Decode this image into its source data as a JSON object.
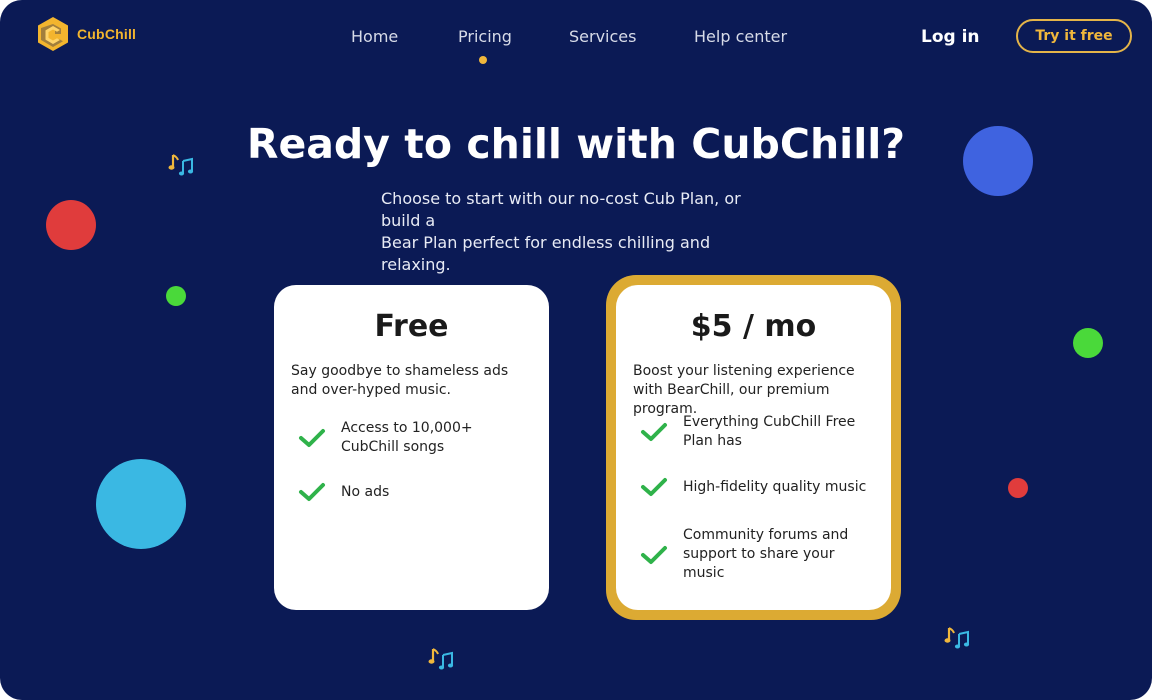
{
  "brand": {
    "name": "CubChill",
    "accent": "#f0b73c",
    "background": "#0b1a55"
  },
  "nav": {
    "items": [
      {
        "label": "Home"
      },
      {
        "label": "Pricing",
        "active": true
      },
      {
        "label": "Services"
      },
      {
        "label": "Help center"
      }
    ],
    "login_label": "Log in",
    "cta_label": "Try it free"
  },
  "hero": {
    "title": "Ready to chill with CubChill?",
    "subtitle_line1": "Choose to start with our no-cost Cub Plan, or build a",
    "subtitle_line2": "Bear Plan perfect for endless chilling and relaxing."
  },
  "plans": [
    {
      "title": "Free",
      "description": "Say goodbye to shameless ads and over-hyped music.",
      "features": [
        {
          "text": "Access to 10,000+ CubChill songs"
        },
        {
          "text": "No ads"
        }
      ]
    },
    {
      "title": "$5 / mo",
      "description": "Boost your listening experience with BearChill, our premium program.",
      "highlight_color": "#dcaa33",
      "features": [
        {
          "text": "Everything CubChill Free Plan has"
        },
        {
          "text": "High-fidelity quality music"
        },
        {
          "text": "Community forums and support to share your music"
        }
      ]
    }
  ],
  "icons": {
    "check": "check-icon",
    "note": "music-note-icon",
    "logo": "cubchill-logo-icon"
  },
  "colors": {
    "check": "#2fb24a",
    "dot_red": "#e03c3c",
    "dot_green": "#4ad93a",
    "dot_blue": "#3f63e0",
    "dot_cyan": "#3ab8e3"
  }
}
